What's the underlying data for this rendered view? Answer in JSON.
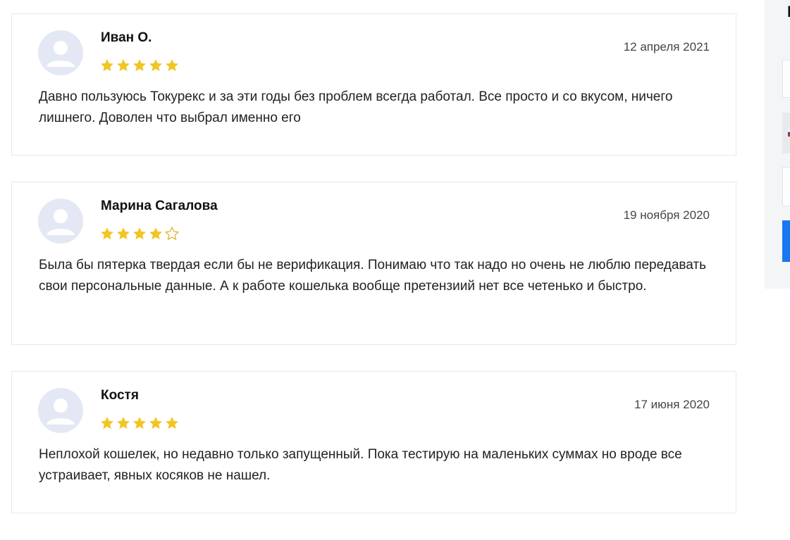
{
  "reviews": [
    {
      "author": "Иван О.",
      "date": "12 апреля 2021",
      "rating": 5,
      "text": "Давно пользуюсь Токурекс и за эти годы без проблем всегда работал. Все просто и со вкусом, ничего лишнего. Доволен что выбрал именно его"
    },
    {
      "author": "Марина Сагалова",
      "date": "19 ноября 2020",
      "rating": 4,
      "text": "Была бы пятерка твердая если бы не верификация. Понимаю что так надо но очень не люблю передавать свои персональные данные. А к работе кошелька вообще претензиий нет все четенько и быстро."
    },
    {
      "author": "Костя",
      "date": "17 июня 2020",
      "rating": 5,
      "text": "Неплохой кошелек, но недавно только запущенный. Пока тестирую на маленьких суммах но вроде все устраивает, явных косяков не нашел."
    }
  ],
  "sidebar": {
    "heading_fragment": "I",
    "button_color": "#1877f2"
  },
  "colors": {
    "star_filled": "#f2c521",
    "star_empty_stroke": "#e0b32a",
    "avatar_bg": "#e3e8f4",
    "avatar_icon": "#ffffff"
  },
  "icons": {
    "avatar": "user-avatar-icon",
    "star_filled": "star-filled-icon",
    "star_empty": "star-outline-icon"
  }
}
